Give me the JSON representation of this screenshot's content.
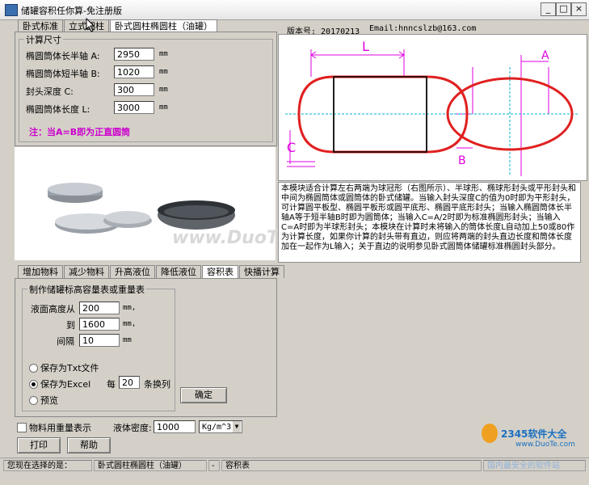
{
  "window": {
    "title": "储罐容积任你算-免注册版",
    "controls": {
      "minimize": "_",
      "maximize": "□",
      "close": "×"
    }
  },
  "top_tabs": [
    "卧式标准",
    "立式圆柱",
    "卧式圆柱椭圆柱（油罐）"
  ],
  "calc_group": {
    "legend": "计算尺寸",
    "fields": [
      {
        "label": "椭圆筒体长半轴 A:",
        "value": "2950",
        "unit": "mm"
      },
      {
        "label": "椭圆筒体短半轴 B:",
        "value": "1020",
        "unit": "mm"
      },
      {
        "label": "封头深度 C:",
        "value": "300",
        "unit": "mm"
      },
      {
        "label": "椭圆筒体长度 L:",
        "value": "3000",
        "unit": "mm"
      }
    ],
    "note": "注：当A=B即为正直圆筒"
  },
  "version_line": {
    "version": "版本号: 20170213",
    "email": "Email:hnncslzb@163.com"
  },
  "diagram": {
    "label_L": "L",
    "label_A": "A",
    "label_B": "B",
    "label_C": "C"
  },
  "description": "本模块适合计算左右两端为球冠形（右图所示）、半球形、椭球形封头或平形封头和中间为椭圆筒体或圆筒体的卧式储罐。当输入封头深度C的值为0时即为平形封头，可计算圆平板型、椭圆平板形或圆平底形、椭圆平底形封头；当输入椭圆筒体长半轴A等于短半轴B时即为圆筒体；当输入C=A/2时即为标准椭圆形封头；当输入C=A时即为半球形封头；本模块在计算时未将输入的筒体长度L自动加上50或80作为计算长度，如果你计算的封头带有直边，则应将两端的封头直边长度和筒体长度加在一起作为L输入；关于直边的说明参见卧式圆筒体储罐标准椭圆封头部分。",
  "watermark": "www.DuoTe.com",
  "bottom_tabs": [
    "增加物料",
    "减少物料",
    "升高液位",
    "降低液位",
    "容积表",
    "快播计算"
  ],
  "table_group": {
    "legend": "制作储罐标高容量表或重量表",
    "from_label": "液面高度从",
    "from_value": "200",
    "from_unit": "mm,",
    "to_label": "到",
    "to_value": "1600",
    "to_unit": "mm,",
    "step_label": "间隔",
    "step_value": "10",
    "step_unit": "mm",
    "options": [
      {
        "label": "保存为Txt文件",
        "selected": false
      },
      {
        "label": "保存为Excel",
        "selected": true
      },
      {
        "label": "预览",
        "selected": false
      }
    ],
    "every_label": "每",
    "every_value": "20",
    "every_suffix": "条换列",
    "confirm_button": "确定"
  },
  "weight_checkbox": "物料用重量表示",
  "density_label": "液体密度:",
  "density_value": "1000",
  "density_unit": "Kg/m^3",
  "print_button": "打印",
  "help_button": "帮助",
  "status": {
    "selected_label": "您现在选择的是：",
    "module": "卧式圆柱椭圆柱（油罐）",
    "sep": "-",
    "page": "容积表"
  },
  "corner_logo": "2345软件大全",
  "corner_site": "www.DuoTe.com",
  "corner_text": "国内最安全的软件站",
  "colors": {
    "note_red": "#cc00cc",
    "tank_red": "#e02020",
    "dim_magenta": "#e000e0",
    "axis_cyan": "#00b0d0"
  }
}
